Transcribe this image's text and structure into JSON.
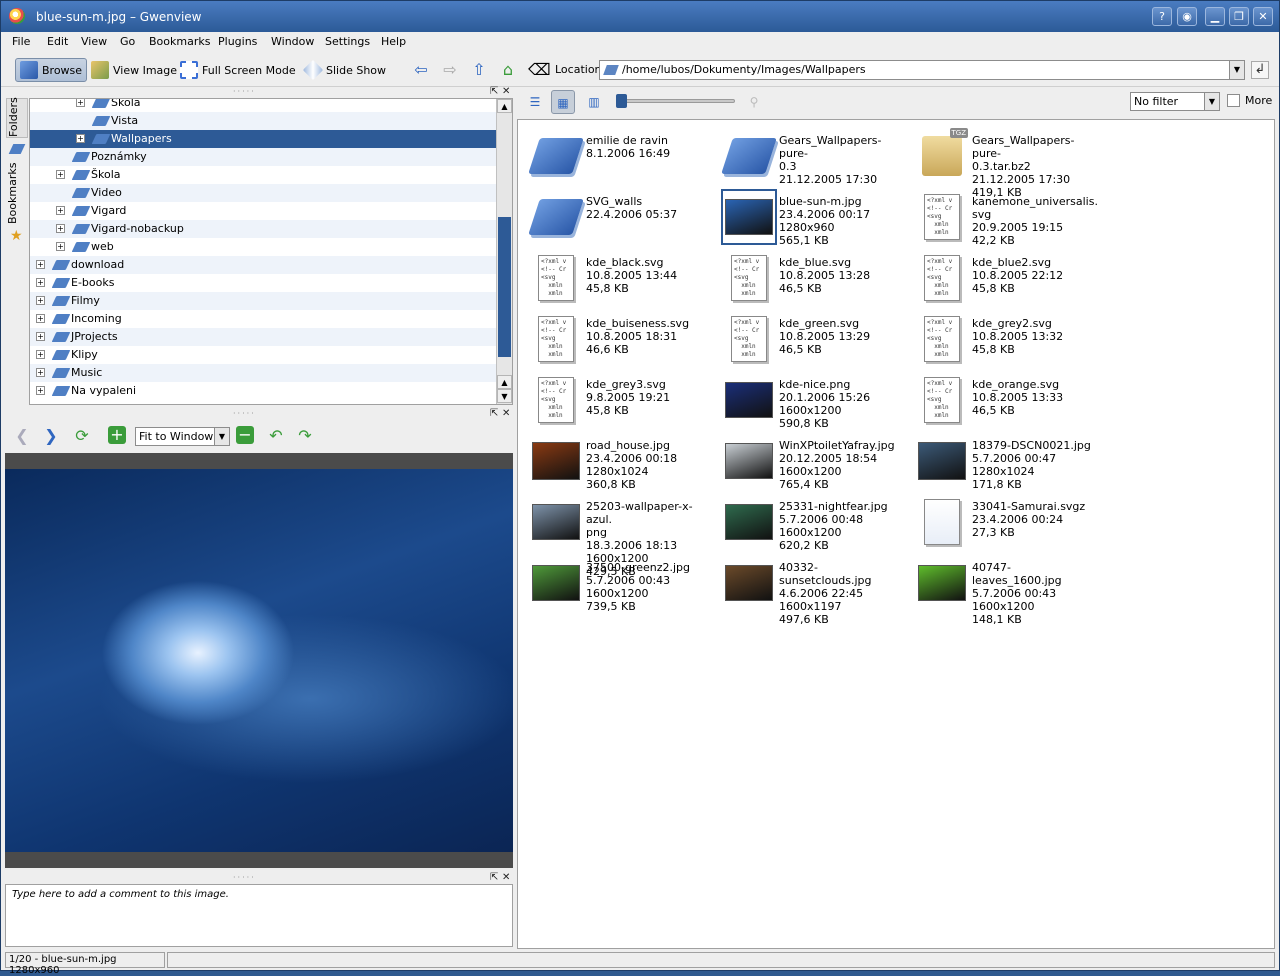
{
  "window": {
    "title": "blue-sun-m.jpg – Gwenview"
  },
  "menu": [
    "File",
    "Edit",
    "View",
    "Go",
    "Bookmarks",
    "Plugins",
    "Window",
    "Settings",
    "Help"
  ],
  "toolbar": {
    "browse": "Browse",
    "view_image": "View Image",
    "full_screen": "Full Screen Mode",
    "slide_show": "Slide Show",
    "location_label": "Location:",
    "location_value": "/home/lubos/Dokumenty/Images/Wallpapers"
  },
  "side_tabs": {
    "folders": "Folders",
    "bookmarks": "Bookmarks"
  },
  "tree": [
    {
      "label": "Škola",
      "depth": 3,
      "expandable": true
    },
    {
      "label": "Vista",
      "depth": 3,
      "expandable": false
    },
    {
      "label": "Wallpapers",
      "depth": 3,
      "expandable": true,
      "selected": true
    },
    {
      "label": "Poznámky",
      "depth": 2,
      "expandable": false
    },
    {
      "label": "Škola",
      "depth": 2,
      "expandable": true
    },
    {
      "label": "Video",
      "depth": 2,
      "expandable": false
    },
    {
      "label": "Vigard",
      "depth": 2,
      "expandable": true
    },
    {
      "label": "Vigard-nobackup",
      "depth": 2,
      "expandable": true
    },
    {
      "label": "web",
      "depth": 2,
      "expandable": true
    },
    {
      "label": "download",
      "depth": 1,
      "expandable": true
    },
    {
      "label": "E-books",
      "depth": 1,
      "expandable": true
    },
    {
      "label": "Filmy",
      "depth": 1,
      "expandable": true
    },
    {
      "label": "Incoming",
      "depth": 1,
      "expandable": true
    },
    {
      "label": "JProjects",
      "depth": 1,
      "expandable": true
    },
    {
      "label": "Klipy",
      "depth": 1,
      "expandable": true
    },
    {
      "label": "Music",
      "depth": 1,
      "expandable": true
    },
    {
      "label": "Na vypaleni",
      "depth": 1,
      "expandable": true
    }
  ],
  "image_toolbar": {
    "zoom_mode": "Fit to Window"
  },
  "comment": {
    "placeholder": "Type here to add a comment to this image."
  },
  "browser_toolbar": {
    "filter": "No filter",
    "more": "More"
  },
  "files": [
    {
      "name": "emilie de ravin",
      "date": "8.1.2006 16:49",
      "res": "",
      "size": "",
      "kind": "folder"
    },
    {
      "name": "Gears_Wallpapers-pure-\n0.3",
      "date": "21.12.2005 17:30",
      "res": "",
      "size": "",
      "kind": "folder"
    },
    {
      "name": "Gears_Wallpapers-pure-\n0.3.tar.bz2",
      "date": "21.12.2005 17:30",
      "res": "",
      "size": "419,1 KB",
      "kind": "archive"
    },
    {
      "name": "SVG_walls",
      "date": "22.4.2006 05:37",
      "res": "",
      "size": "",
      "kind": "folder"
    },
    {
      "name": "blue-sun-m.jpg",
      "date": "23.4.2006 00:17",
      "res": "1280x960",
      "size": "565,1 KB",
      "kind": "pic",
      "color": "#2a64b4",
      "selected": true
    },
    {
      "name": "kanemone_universalis.\nsvg",
      "date": "20.9.2005 19:15",
      "res": "",
      "size": "42,2 KB",
      "kind": "svg"
    },
    {
      "name": "kde_black.svg",
      "date": "10.8.2005 13:44",
      "res": "",
      "size": "45,8 KB",
      "kind": "svg"
    },
    {
      "name": "kde_blue.svg",
      "date": "10.8.2005 13:28",
      "res": "",
      "size": "46,5 KB",
      "kind": "svg"
    },
    {
      "name": "kde_blue2.svg",
      "date": "10.8.2005 22:12",
      "res": "",
      "size": "45,8 KB",
      "kind": "svg"
    },
    {
      "name": "kde_buiseness.svg",
      "date": "10.8.2005 18:31",
      "res": "",
      "size": "46,6 KB",
      "kind": "svg"
    },
    {
      "name": "kde_green.svg",
      "date": "10.8.2005 13:29",
      "res": "",
      "size": "46,5 KB",
      "kind": "svg"
    },
    {
      "name": "kde_grey2.svg",
      "date": "10.8.2005 13:32",
      "res": "",
      "size": "45,8 KB",
      "kind": "svg"
    },
    {
      "name": "kde_grey3.svg",
      "date": "9.8.2005 19:21",
      "res": "",
      "size": "45,8 KB",
      "kind": "svg"
    },
    {
      "name": "kde-nice.png",
      "date": "20.1.2006 15:26",
      "res": "1600x1200",
      "size": "590,8 KB",
      "kind": "pic",
      "color": "#1b2f7a"
    },
    {
      "name": "kde_orange.svg",
      "date": "10.8.2005 13:33",
      "res": "",
      "size": "46,5 KB",
      "kind": "svg"
    },
    {
      "name": "road_house.jpg",
      "date": "23.4.2006 00:18",
      "res": "1280x1024",
      "size": "360,8 KB",
      "kind": "pic",
      "color": "#8a3a12"
    },
    {
      "name": "WinXPtoiletYafray.jpg",
      "date": "20.12.2005 18:54",
      "res": "1600x1200",
      "size": "765,4 KB",
      "kind": "pic",
      "color": "#c9cfd4"
    },
    {
      "name": "18379-DSCN0021.jpg",
      "date": "5.7.2006 00:47",
      "res": "1280x1024",
      "size": "171,8 KB",
      "kind": "pic",
      "color": "#3c5a78"
    },
    {
      "name": "25203-wallpaper-x-azul.\npng",
      "date": "18.3.2006 18:13",
      "res": "1600x1200",
      "size": "429,5 KB",
      "kind": "pic",
      "color": "#7e93aa"
    },
    {
      "name": "25331-nightfear.jpg",
      "date": "5.7.2006 00:48",
      "res": "1600x1200",
      "size": "620,2 KB",
      "kind": "pic",
      "color": "#2f6b4e"
    },
    {
      "name": "33041-Samurai.svgz",
      "date": "23.4.2006 00:24",
      "res": "",
      "size": "27,3 KB",
      "kind": "blank"
    },
    {
      "name": "37500-greenz2.jpg",
      "date": "5.7.2006 00:43",
      "res": "1600x1200",
      "size": "739,5 KB",
      "kind": "pic",
      "color": "#4f9a3a"
    },
    {
      "name": "40332-sunsetclouds.jpg",
      "date": "4.6.2006 22:45",
      "res": "1600x1197",
      "size": "497,6 KB",
      "kind": "pic",
      "color": "#6b4a2a"
    },
    {
      "name": "40747-leaves_1600.jpg",
      "date": "5.7.2006 00:43",
      "res": "1600x1200",
      "size": "148,1 KB",
      "kind": "pic",
      "color": "#5fbd2c"
    }
  ],
  "status": {
    "text": "1/20 - blue-sun-m.jpg 1280x960"
  },
  "colors": {
    "accent": "#2d5a96",
    "titlebar": "#3a6aab"
  }
}
